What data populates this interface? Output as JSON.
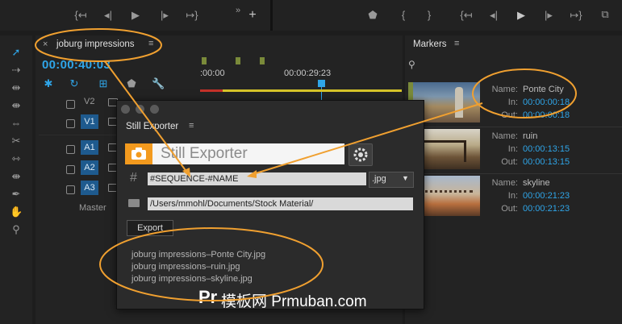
{
  "timeline": {
    "sequence_tab": "joburg impressions",
    "timecode": "00:00:40:03",
    "ruler_start": ":00:00",
    "ruler_mid": "00:00:29:23",
    "tracks": [
      {
        "label": "V2",
        "selected": false
      },
      {
        "label": "V1",
        "selected": true
      },
      {
        "label": "A1",
        "selected": true
      },
      {
        "label": "A2",
        "selected": true
      },
      {
        "label": "A3",
        "selected": true
      },
      {
        "label": "Master",
        "selected": false
      }
    ]
  },
  "still_exporter": {
    "panel_title": "Still Exporter",
    "brand_title": "Still Exporter",
    "hash_symbol": "#",
    "pattern_value": "#SEQUENCE-#NAME",
    "format_value": ".jpg",
    "folder_value": "/Users/mmohl/Documents/Stock Material/",
    "export_button": "Export",
    "output_files": [
      "joburg impressions–Ponte City.jpg",
      "joburg impressions–ruin.jpg",
      "joburg impressions–skyline.jpg"
    ]
  },
  "markers": {
    "panel_title": "Markers",
    "name_label": "Name:",
    "in_label": "In:",
    "out_label": "Out:",
    "items": [
      {
        "name": "Ponte City",
        "in": "00:00:00:18",
        "out": "00:00:00:18"
      },
      {
        "name": "ruin",
        "in": "00:00:13:15",
        "out": "00:00:13:15"
      },
      {
        "name": "skyline",
        "in": "00:00:21:23",
        "out": "00:00:21:23"
      }
    ]
  },
  "watermark": {
    "logo_text": "Pr",
    "site_text": "模板网 Prmuban.com"
  },
  "colors": {
    "accent_blue": "#2fa5e8",
    "annotation_orange": "#f0a030",
    "brand_orange": "#f39a1e",
    "track_selected": "#1e5a8e"
  }
}
